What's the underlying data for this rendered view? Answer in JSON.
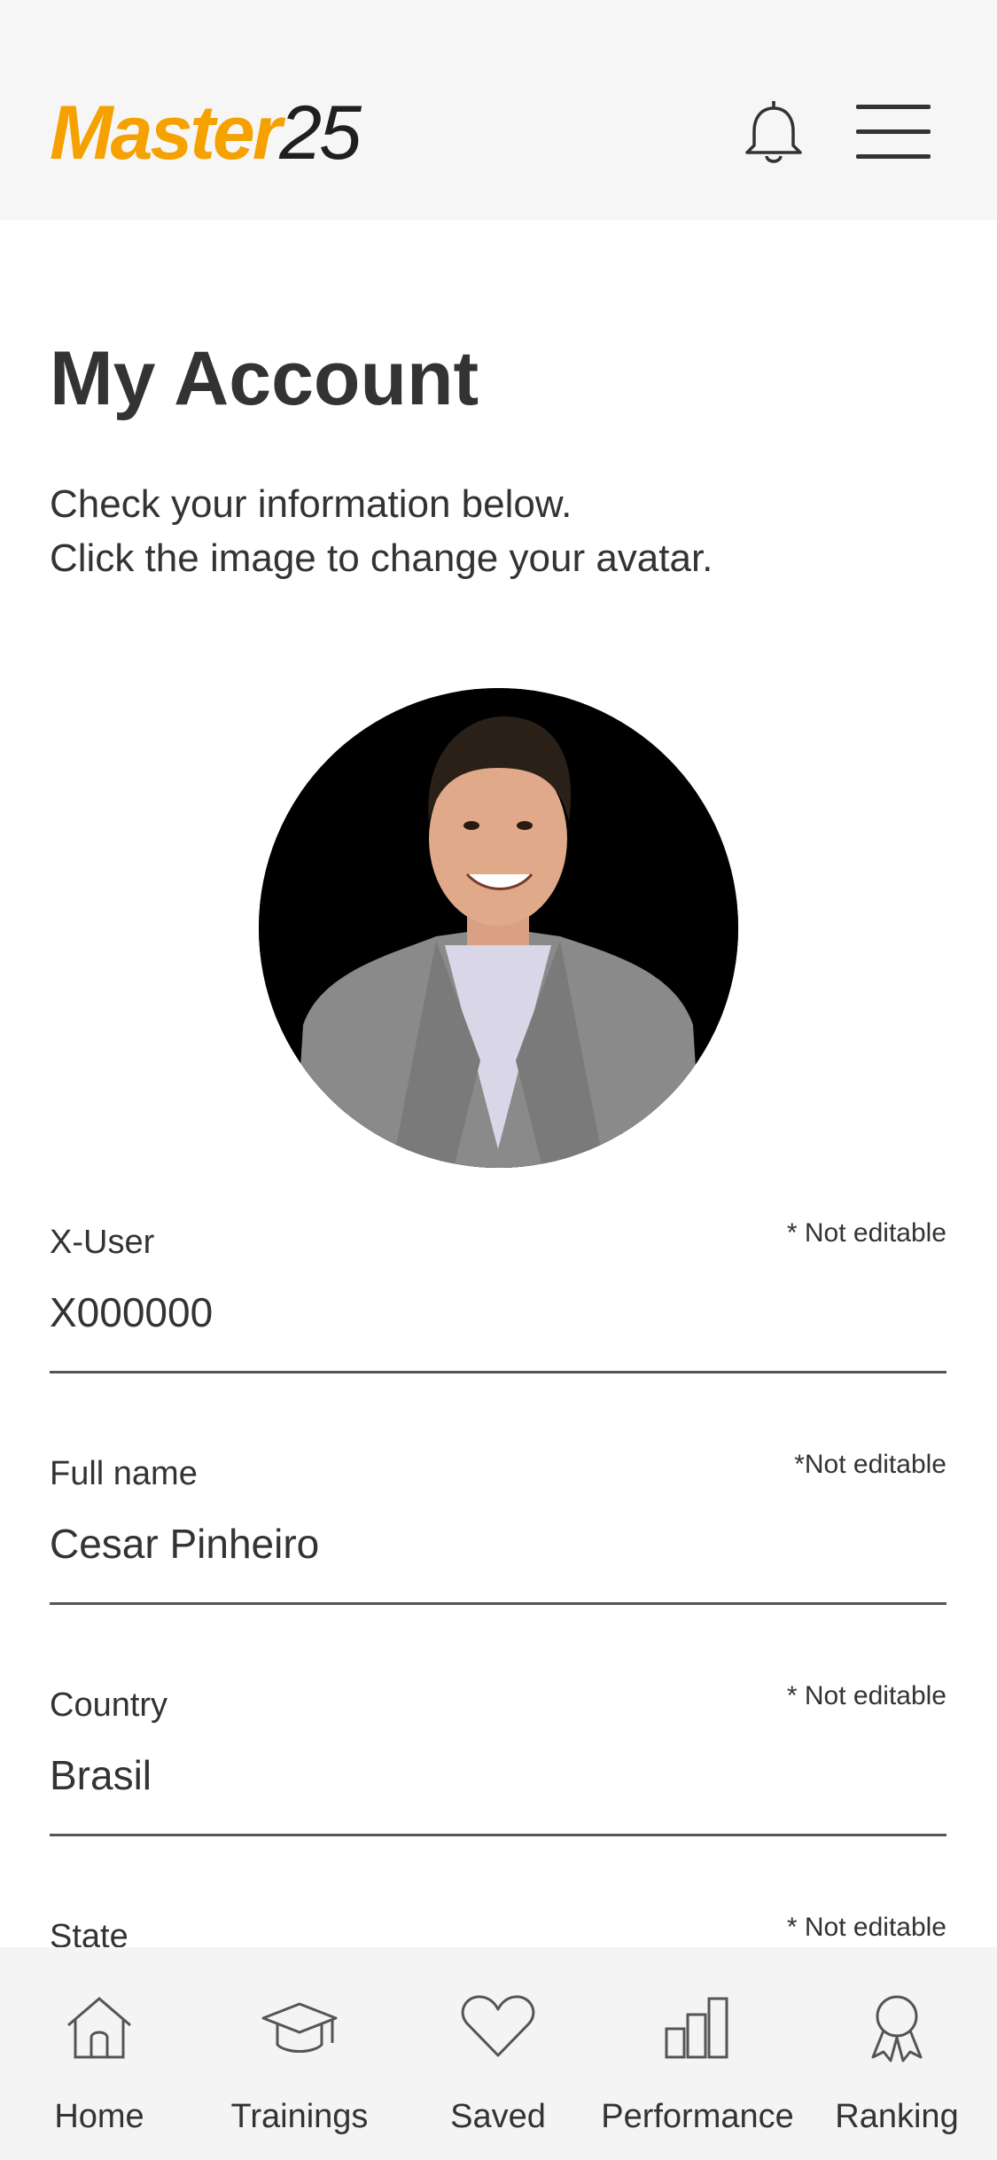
{
  "header": {
    "logo_part1": "Master",
    "logo_part2": "25",
    "bell_icon": "bell-icon",
    "menu_icon": "hamburger-menu-icon"
  },
  "page": {
    "title": "My Account",
    "subtitle_line1": "Check your information below.",
    "subtitle_line2": "Click the image to change your avatar."
  },
  "avatar": {
    "description_icon": "user-photo-avatar"
  },
  "fields": [
    {
      "label": "X-User",
      "note": "* Not editable",
      "value": "X000000"
    },
    {
      "label": "Full name",
      "note": "*Not editable",
      "value": "Cesar Pinheiro"
    },
    {
      "label": "Country",
      "note": "* Not editable",
      "value": "Brasil"
    },
    {
      "label": "State",
      "note": "* Not editable",
      "value": ""
    }
  ],
  "tabbar": [
    {
      "label": "Home",
      "icon": "home-icon"
    },
    {
      "label": "Trainings",
      "icon": "graduation-cap-icon"
    },
    {
      "label": "Saved",
      "icon": "heart-icon"
    },
    {
      "label": "Performance",
      "icon": "bar-chart-icon"
    },
    {
      "label": "Ranking",
      "icon": "award-ribbon-icon"
    }
  ],
  "colors": {
    "logo_orange": "#f5a100",
    "text": "#333333",
    "header_bg": "#f6f6f6",
    "tabbar_bg": "#f4f4f4"
  }
}
